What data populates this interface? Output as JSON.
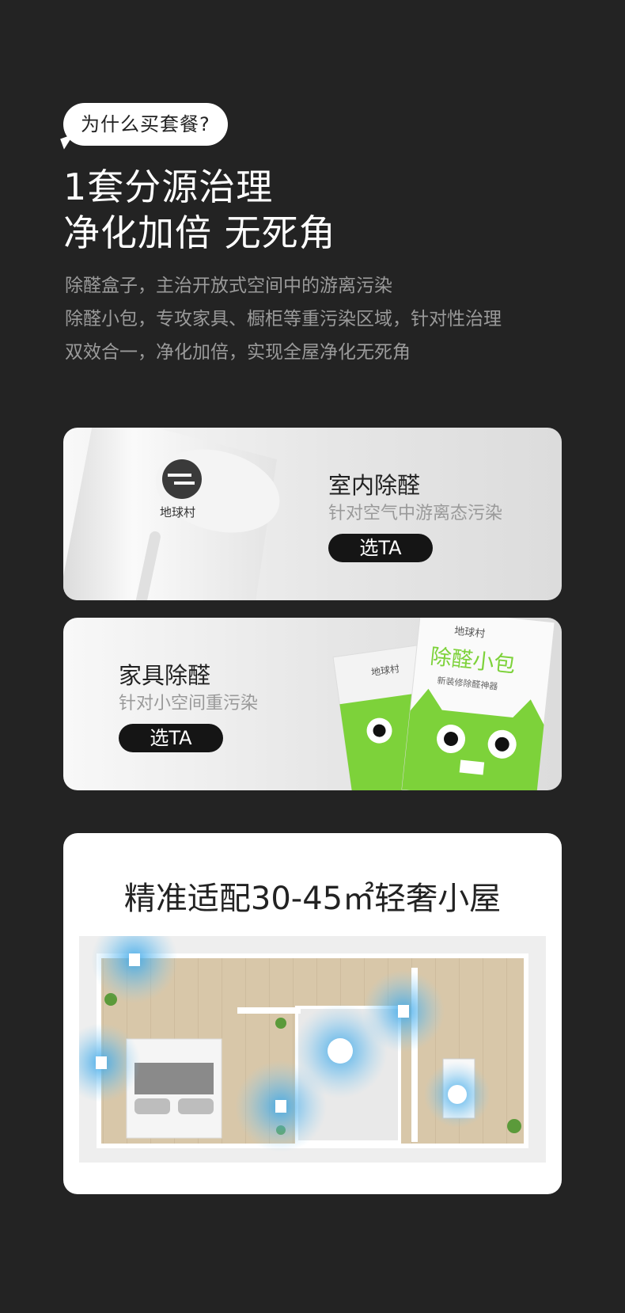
{
  "intro": {
    "question": "为什么买套餐?",
    "headline_line1": "1套分源治理",
    "headline_line2": "净化加倍 无死角",
    "desc_lines": [
      "除醛盒子，主治开放式空间中的游离污染",
      "除醛小包，专攻家具、橱柜等重污染区域，针对性治理",
      "双效合一，净化加倍，实现全屋净化无死角"
    ]
  },
  "cards": [
    {
      "title": "室内除醛",
      "subtitle": "针对空气中游离态污染",
      "button": "选TA",
      "product_logo": "地球村"
    },
    {
      "title": "家具除醛",
      "subtitle": "针对小空间重污染",
      "button": "选TA",
      "pack_label": "除醛小包",
      "pack_small": "新装修除醛神器",
      "pack_logo": "地球村"
    }
  ],
  "section": {
    "title": "精准适配30-45㎡轻奢小屋"
  },
  "colors": {
    "background": "#232323",
    "accent_green": "#7dd23a",
    "ripple_blue": "#3aa6e8"
  }
}
